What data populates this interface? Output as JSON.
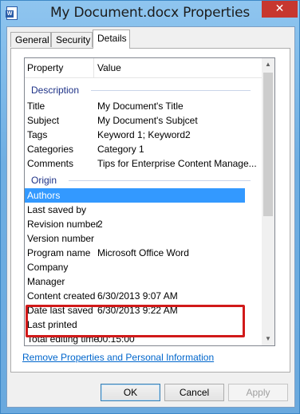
{
  "window": {
    "title": "My Document.docx Properties",
    "close_glyph": "✕",
    "app_icon": "word-document-icon"
  },
  "tabs": [
    {
      "label": "General",
      "active": false
    },
    {
      "label": "Security",
      "active": false
    },
    {
      "label": "Details",
      "active": true
    }
  ],
  "list": {
    "header": {
      "property": "Property",
      "value": "Value"
    },
    "groups": {
      "description": "Description",
      "origin": "Origin"
    },
    "rows": [
      {
        "property": "Title",
        "value": "My Document's Title"
      },
      {
        "property": "Subject",
        "value": "My Document's Subjcet"
      },
      {
        "property": "Tags",
        "value": "Keyword 1; Keyword2"
      },
      {
        "property": "Categories",
        "value": "Category 1"
      },
      {
        "property": "Comments",
        "value": "Tips for Enterprise Content Manage..."
      },
      {
        "property": "Authors",
        "value": "",
        "selected": true
      },
      {
        "property": "Last saved by",
        "value": ""
      },
      {
        "property": "Revision number",
        "value": "2"
      },
      {
        "property": "Version number",
        "value": ""
      },
      {
        "property": "Program name",
        "value": "Microsoft Office Word"
      },
      {
        "property": "Company",
        "value": ""
      },
      {
        "property": "Manager",
        "value": ""
      },
      {
        "property": "Content created",
        "value": "6/30/2013 9:07 AM"
      },
      {
        "property": "Date last saved",
        "value": "6/30/2013 9:22 AM"
      },
      {
        "property": "Last printed",
        "value": ""
      },
      {
        "property": "Total editing time",
        "value": "00:15:00"
      }
    ]
  },
  "remove_link": "Remove Properties and Personal Information",
  "buttons": {
    "ok": "OK",
    "cancel": "Cancel",
    "apply": "Apply"
  },
  "colors": {
    "selection": "#3399ff",
    "highlight_box": "#d11a1a",
    "link": "#0066cc",
    "group_heading": "#1e3287"
  }
}
